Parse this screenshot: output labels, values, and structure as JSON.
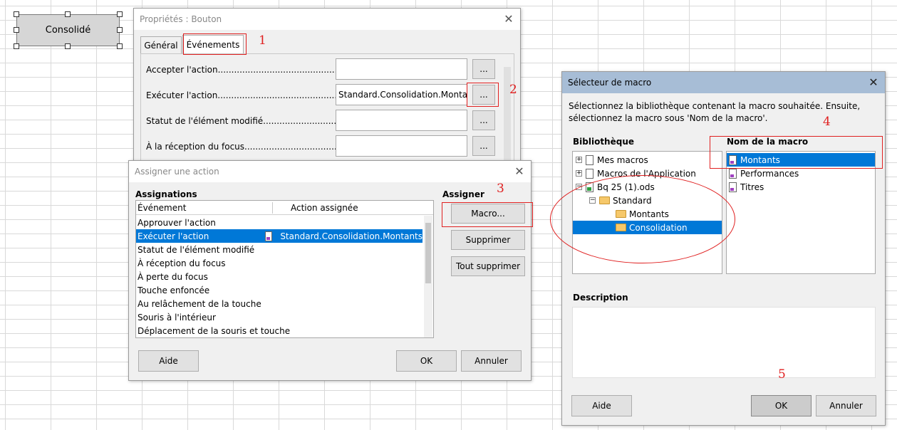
{
  "sheet": {
    "button_label": "Consolidé"
  },
  "props_dialog": {
    "title": "Propriétés : Bouton",
    "tabs": [
      "Général",
      "Événements"
    ],
    "rows": [
      {
        "label": "Accepter l'action.......................................................",
        "value": ""
      },
      {
        "label": "Exécuter l'action.......................................................",
        "value": "Standard.Consolidation.Montants"
      },
      {
        "label": "Statut de l'élément modifié.......................................",
        "value": ""
      },
      {
        "label": "À la réception du focus.............................................",
        "value": ""
      }
    ],
    "dots_label": "..."
  },
  "assign_dialog": {
    "title": "Assigner une action",
    "assignations_heading": "Assignations",
    "col_event": "Événement",
    "col_action": "Action assignée",
    "events": [
      "Approuver l'action",
      "Exécuter l'action",
      "Statut de l'élément modifié",
      "À réception du focus",
      "À perte du focus",
      "Touche enfoncée",
      "Au relâchement de la touche",
      "Souris à l'intérieur",
      "Déplacement de la souris et touche"
    ],
    "assigned_action": "Standard.Consolidation.Montants",
    "assign_heading": "Assigner",
    "macro_button": "Macro...",
    "remove_button": "Supprimer",
    "remove_all_button": "Tout supprimer",
    "help_button": "Aide",
    "ok_button": "OK",
    "cancel_button": "Annuler"
  },
  "macro_dialog": {
    "title": "Sélecteur de macro",
    "instructions": "Sélectionnez la bibliothèque contenant la macro souhaitée. Ensuite, sélectionnez la macro sous 'Nom de la macro'.",
    "library_heading": "Bibliothèque",
    "tree": [
      "Mes macros",
      "Macros de l'Application",
      "Bq 25 (1).ods",
      "Standard",
      "Montants",
      "Consolidation"
    ],
    "macro_name_heading": "Nom de la macro",
    "macros": [
      "Montants",
      "Performances",
      "Titres"
    ],
    "description_heading": "Description",
    "help_button": "Aide",
    "ok_button": "OK",
    "cancel_button": "Annuler"
  },
  "annotations": [
    "1",
    "2",
    "3",
    "4",
    "5"
  ],
  "colors": {
    "annotation_red": "#e02020",
    "selection_blue": "#0078d7",
    "active_title": "#a7bdd6"
  }
}
